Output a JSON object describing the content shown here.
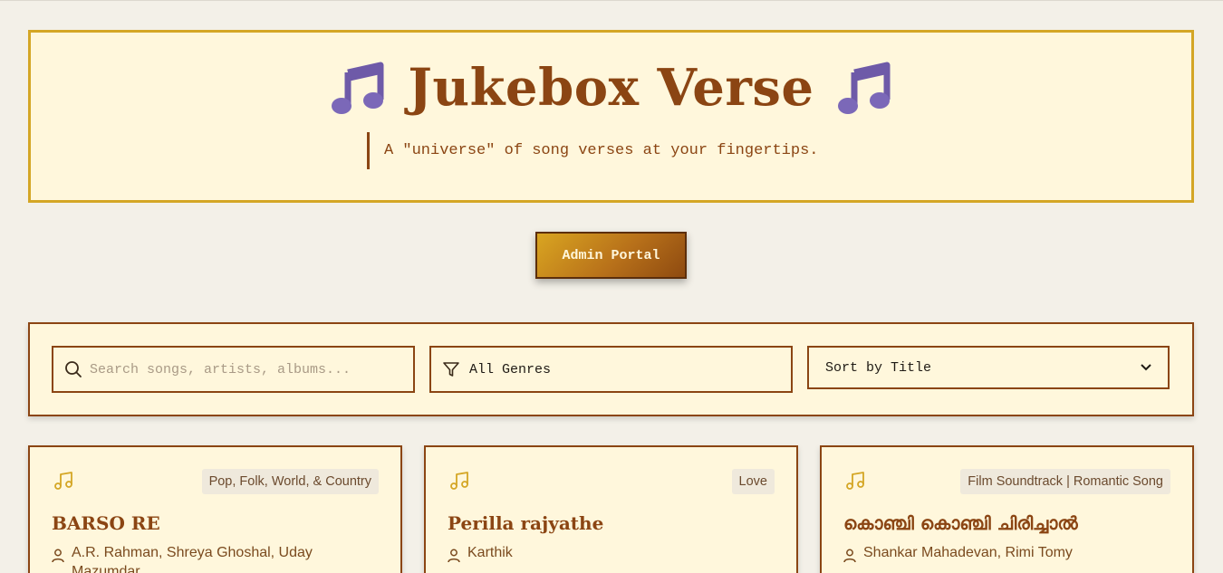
{
  "header": {
    "title": "Jukebox Verse",
    "tagline": "A \"universe\" of song verses at your fingertips.",
    "left_icon": "music-note-icon",
    "right_icon": "music-note-icon"
  },
  "admin": {
    "label": "Admin Portal"
  },
  "filters": {
    "search_placeholder": "Search songs, artists, albums...",
    "search_value": "",
    "genre_selected": "All Genres",
    "sort_selected": "Sort by Title"
  },
  "songs": [
    {
      "title": "BARSO RE",
      "genre": "Pop, Folk, World, & Country",
      "artists": "A.R. Rahman, Shreya Ghoshal, Uday Mazumdar"
    },
    {
      "title": "Perilla rajyathe",
      "genre": "Love",
      "artists": "Karthik"
    },
    {
      "title": "കൊഞ്ചി കൊഞ്ചി ചിരിച്ചാൽ",
      "genre": "Film Soundtrack | Romantic Song",
      "artists": "Shankar Mahadevan, Rimi Tomy"
    }
  ],
  "colors": {
    "background": "#f3f0e8",
    "panel": "#fff7dc",
    "brown": "#8b4513",
    "gold": "#d4a625",
    "note_purple": "#7b68b8"
  }
}
